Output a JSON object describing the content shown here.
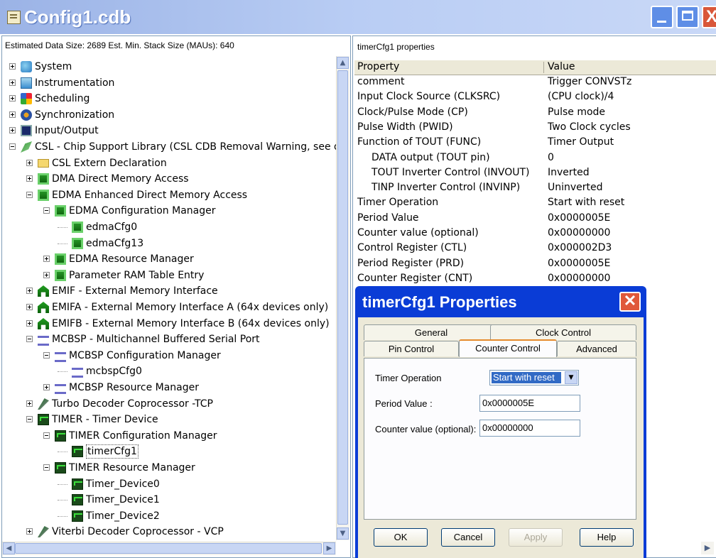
{
  "window": {
    "title": "Config1.cdb"
  },
  "left_header": "Estimated Data Size: 2689  Est. Min. Stack Size (MAUs): 640",
  "tree": [
    {
      "label": "System",
      "icon": "system-icon"
    },
    {
      "label": "Instrumentation",
      "icon": "instrumentation-icon"
    },
    {
      "label": "Scheduling",
      "icon": "scheduling-icon"
    },
    {
      "label": "Synchronization",
      "icon": "synchronization-icon"
    },
    {
      "label": "Input/Output",
      "icon": "io-icon"
    },
    {
      "label": "CSL - Chip Support Library (CSL CDB Removal Warning, see d",
      "icon": "csl-icon"
    },
    {
      "label": "CSL Extern Declaration",
      "icon": "folder-icon"
    },
    {
      "label": "DMA Direct Memory Access",
      "icon": "dma-icon"
    },
    {
      "label": "EDMA Enhanced Direct Memory Access",
      "icon": "dma-icon"
    },
    {
      "label": "EDMA Configuration Manager",
      "icon": "dma-icon"
    },
    {
      "label": "edmaCfg0",
      "icon": "dma-icon"
    },
    {
      "label": "edmaCfg13",
      "icon": "dma-icon"
    },
    {
      "label": "EDMA Resource Manager",
      "icon": "dma-icon"
    },
    {
      "label": "Parameter RAM Table Entry",
      "icon": "dma-icon"
    },
    {
      "label": "EMIF - External Memory Interface",
      "icon": "emif-icon"
    },
    {
      "label": "EMIFA - External Memory Interface A (64x devices only)",
      "icon": "emif-icon"
    },
    {
      "label": "EMIFB - External Memory Interface B (64x devices only)",
      "icon": "emif-icon"
    },
    {
      "label": "MCBSP - Multichannel Buffered Serial Port",
      "icon": "mcbsp-icon"
    },
    {
      "label": "MCBSP Configuration Manager",
      "icon": "mcbsp-icon"
    },
    {
      "label": "mcbspCfg0",
      "icon": "mcbsp-icon"
    },
    {
      "label": "MCBSP Resource Manager",
      "icon": "mcbsp-icon"
    },
    {
      "label": "Turbo Decoder Coprocessor -TCP",
      "icon": "coprocessor-icon"
    },
    {
      "label": "TIMER - Timer Device",
      "icon": "timer-icon"
    },
    {
      "label": "TIMER Configuration Manager",
      "icon": "timer-icon"
    },
    {
      "label": "timerCfg1",
      "icon": "timer-icon"
    },
    {
      "label": "TIMER Resource Manager",
      "icon": "timer-icon"
    },
    {
      "label": "Timer_Device0",
      "icon": "timer-icon"
    },
    {
      "label": "Timer_Device1",
      "icon": "timer-icon"
    },
    {
      "label": "Timer_Device2",
      "icon": "timer-icon"
    },
    {
      "label": "Viterbi Decoder Coprocessor - VCP",
      "icon": "coprocessor-icon"
    }
  ],
  "right_header": "timerCfg1 properties",
  "grid": {
    "col_property": "Property",
    "col_value": "Value",
    "rows": [
      {
        "property": "comment",
        "value": "Trigger CONVSTz"
      },
      {
        "property": "Input Clock Source (CLKSRC)",
        "value": "(CPU clock)/4"
      },
      {
        "property": "Clock/Pulse Mode (CP)",
        "value": "Pulse mode"
      },
      {
        "property": "Pulse Width (PWID)",
        "value": "Two Clock cycles"
      },
      {
        "property": "Function of TOUT (FUNC)",
        "value": "Timer Output"
      },
      {
        "property": "DATA output (TOUT pin)",
        "value": "0"
      },
      {
        "property": "TOUT Inverter Control (INVOUT)",
        "value": "Inverted"
      },
      {
        "property": "TINP Inverter Control (INVINP)",
        "value": "Uninverted"
      },
      {
        "property": "Timer Operation",
        "value": "Start with reset"
      },
      {
        "property": "Period Value",
        "value": "0x0000005E"
      },
      {
        "property": "Counter value (optional)",
        "value": "0x00000000"
      },
      {
        "property": "Control Register (CTL)",
        "value": "0x000002D3"
      },
      {
        "property": "Period Register (PRD)",
        "value": "0x0000005E"
      },
      {
        "property": "Counter Register (CNT)",
        "value": "0x00000000"
      }
    ]
  },
  "dialog": {
    "title": "timerCfg1 Properties",
    "tabs_back": [
      "General",
      "Clock Control"
    ],
    "tabs_front": [
      "Pin Control",
      "Counter Control",
      "Advanced"
    ],
    "fields": {
      "timer_operation_label": "Timer Operation",
      "timer_operation_value": "Start with reset",
      "period_label": "Period Value :",
      "period_value": "0x0000005E",
      "counter_label": "Counter value (optional):",
      "counter_value": "0x00000000"
    },
    "buttons": {
      "ok": "OK",
      "cancel": "Cancel",
      "apply": "Apply",
      "help": "Help"
    }
  },
  "colors": {
    "titlebar": "#9bb3e6",
    "dialog_title": "#0a3cd6",
    "selection": "#316ac5"
  }
}
